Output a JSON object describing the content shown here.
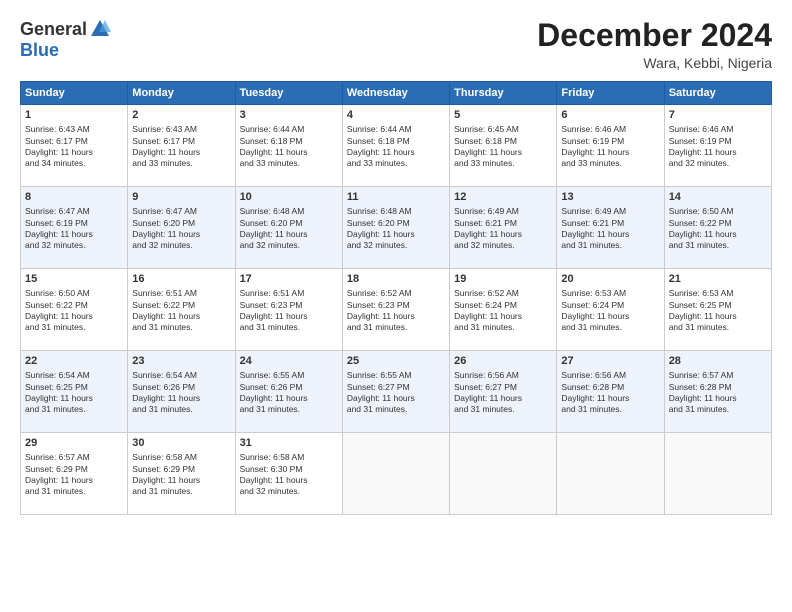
{
  "header": {
    "logo_general": "General",
    "logo_blue": "Blue",
    "month_title": "December 2024",
    "location": "Wara, Kebbi, Nigeria"
  },
  "days_of_week": [
    "Sunday",
    "Monday",
    "Tuesday",
    "Wednesday",
    "Thursday",
    "Friday",
    "Saturday"
  ],
  "weeks": [
    [
      {
        "day": "1",
        "lines": [
          "Sunrise: 6:43 AM",
          "Sunset: 6:17 PM",
          "Daylight: 11 hours",
          "and 34 minutes."
        ]
      },
      {
        "day": "2",
        "lines": [
          "Sunrise: 6:43 AM",
          "Sunset: 6:17 PM",
          "Daylight: 11 hours",
          "and 33 minutes."
        ]
      },
      {
        "day": "3",
        "lines": [
          "Sunrise: 6:44 AM",
          "Sunset: 6:18 PM",
          "Daylight: 11 hours",
          "and 33 minutes."
        ]
      },
      {
        "day": "4",
        "lines": [
          "Sunrise: 6:44 AM",
          "Sunset: 6:18 PM",
          "Daylight: 11 hours",
          "and 33 minutes."
        ]
      },
      {
        "day": "5",
        "lines": [
          "Sunrise: 6:45 AM",
          "Sunset: 6:18 PM",
          "Daylight: 11 hours",
          "and 33 minutes."
        ]
      },
      {
        "day": "6",
        "lines": [
          "Sunrise: 6:46 AM",
          "Sunset: 6:19 PM",
          "Daylight: 11 hours",
          "and 33 minutes."
        ]
      },
      {
        "day": "7",
        "lines": [
          "Sunrise: 6:46 AM",
          "Sunset: 6:19 PM",
          "Daylight: 11 hours",
          "and 32 minutes."
        ]
      }
    ],
    [
      {
        "day": "8",
        "lines": [
          "Sunrise: 6:47 AM",
          "Sunset: 6:19 PM",
          "Daylight: 11 hours",
          "and 32 minutes."
        ]
      },
      {
        "day": "9",
        "lines": [
          "Sunrise: 6:47 AM",
          "Sunset: 6:20 PM",
          "Daylight: 11 hours",
          "and 32 minutes."
        ]
      },
      {
        "day": "10",
        "lines": [
          "Sunrise: 6:48 AM",
          "Sunset: 6:20 PM",
          "Daylight: 11 hours",
          "and 32 minutes."
        ]
      },
      {
        "day": "11",
        "lines": [
          "Sunrise: 6:48 AM",
          "Sunset: 6:20 PM",
          "Daylight: 11 hours",
          "and 32 minutes."
        ]
      },
      {
        "day": "12",
        "lines": [
          "Sunrise: 6:49 AM",
          "Sunset: 6:21 PM",
          "Daylight: 11 hours",
          "and 32 minutes."
        ]
      },
      {
        "day": "13",
        "lines": [
          "Sunrise: 6:49 AM",
          "Sunset: 6:21 PM",
          "Daylight: 11 hours",
          "and 31 minutes."
        ]
      },
      {
        "day": "14",
        "lines": [
          "Sunrise: 6:50 AM",
          "Sunset: 6:22 PM",
          "Daylight: 11 hours",
          "and 31 minutes."
        ]
      }
    ],
    [
      {
        "day": "15",
        "lines": [
          "Sunrise: 6:50 AM",
          "Sunset: 6:22 PM",
          "Daylight: 11 hours",
          "and 31 minutes."
        ]
      },
      {
        "day": "16",
        "lines": [
          "Sunrise: 6:51 AM",
          "Sunset: 6:22 PM",
          "Daylight: 11 hours",
          "and 31 minutes."
        ]
      },
      {
        "day": "17",
        "lines": [
          "Sunrise: 6:51 AM",
          "Sunset: 6:23 PM",
          "Daylight: 11 hours",
          "and 31 minutes."
        ]
      },
      {
        "day": "18",
        "lines": [
          "Sunrise: 6:52 AM",
          "Sunset: 6:23 PM",
          "Daylight: 11 hours",
          "and 31 minutes."
        ]
      },
      {
        "day": "19",
        "lines": [
          "Sunrise: 6:52 AM",
          "Sunset: 6:24 PM",
          "Daylight: 11 hours",
          "and 31 minutes."
        ]
      },
      {
        "day": "20",
        "lines": [
          "Sunrise: 6:53 AM",
          "Sunset: 6:24 PM",
          "Daylight: 11 hours",
          "and 31 minutes."
        ]
      },
      {
        "day": "21",
        "lines": [
          "Sunrise: 6:53 AM",
          "Sunset: 6:25 PM",
          "Daylight: 11 hours",
          "and 31 minutes."
        ]
      }
    ],
    [
      {
        "day": "22",
        "lines": [
          "Sunrise: 6:54 AM",
          "Sunset: 6:25 PM",
          "Daylight: 11 hours",
          "and 31 minutes."
        ]
      },
      {
        "day": "23",
        "lines": [
          "Sunrise: 6:54 AM",
          "Sunset: 6:26 PM",
          "Daylight: 11 hours",
          "and 31 minutes."
        ]
      },
      {
        "day": "24",
        "lines": [
          "Sunrise: 6:55 AM",
          "Sunset: 6:26 PM",
          "Daylight: 11 hours",
          "and 31 minutes."
        ]
      },
      {
        "day": "25",
        "lines": [
          "Sunrise: 6:55 AM",
          "Sunset: 6:27 PM",
          "Daylight: 11 hours",
          "and 31 minutes."
        ]
      },
      {
        "day": "26",
        "lines": [
          "Sunrise: 6:56 AM",
          "Sunset: 6:27 PM",
          "Daylight: 11 hours",
          "and 31 minutes."
        ]
      },
      {
        "day": "27",
        "lines": [
          "Sunrise: 6:56 AM",
          "Sunset: 6:28 PM",
          "Daylight: 11 hours",
          "and 31 minutes."
        ]
      },
      {
        "day": "28",
        "lines": [
          "Sunrise: 6:57 AM",
          "Sunset: 6:28 PM",
          "Daylight: 11 hours",
          "and 31 minutes."
        ]
      }
    ],
    [
      {
        "day": "29",
        "lines": [
          "Sunrise: 6:57 AM",
          "Sunset: 6:29 PM",
          "Daylight: 11 hours",
          "and 31 minutes."
        ]
      },
      {
        "day": "30",
        "lines": [
          "Sunrise: 6:58 AM",
          "Sunset: 6:29 PM",
          "Daylight: 11 hours",
          "and 31 minutes."
        ]
      },
      {
        "day": "31",
        "lines": [
          "Sunrise: 6:58 AM",
          "Sunset: 6:30 PM",
          "Daylight: 11 hours",
          "and 32 minutes."
        ]
      },
      {
        "day": "",
        "lines": []
      },
      {
        "day": "",
        "lines": []
      },
      {
        "day": "",
        "lines": []
      },
      {
        "day": "",
        "lines": []
      }
    ]
  ]
}
